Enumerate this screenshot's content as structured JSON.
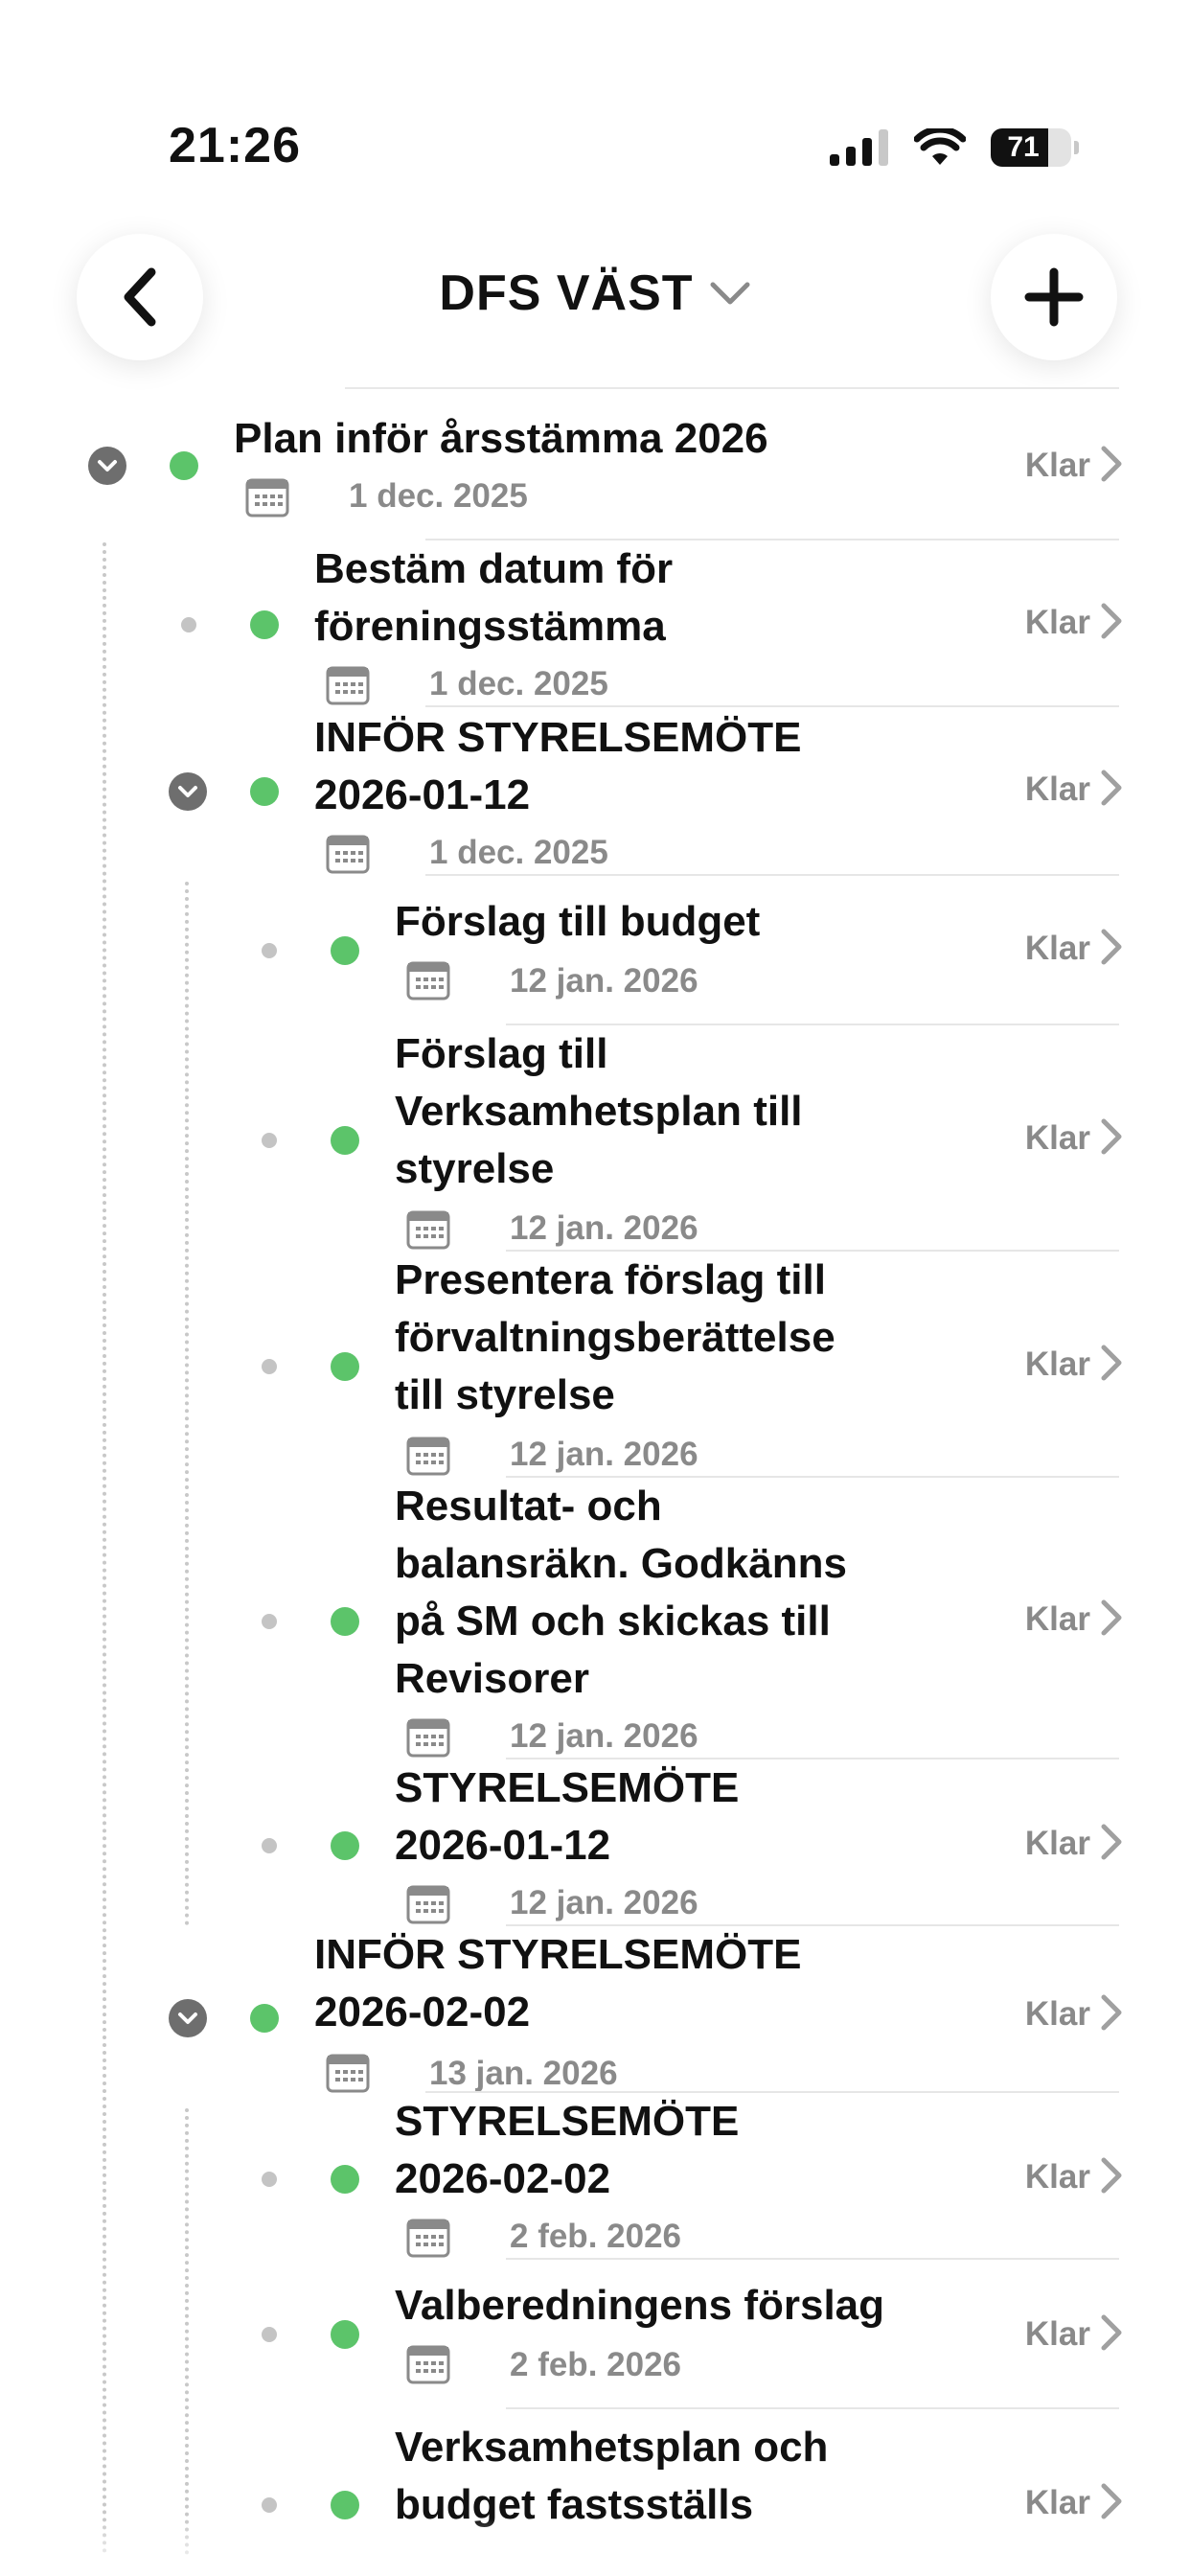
{
  "status_bar": {
    "time": "21:26",
    "battery": "71"
  },
  "header": {
    "title": "DFS VÄST"
  },
  "rows": [
    {
      "title": "Plan inför årsstämma 2026",
      "date": "1 dec. 2025",
      "status": "Klar"
    },
    {
      "title": "Bestäm datum för föreningsstämma",
      "date": "1 dec. 2025",
      "status": "Klar"
    },
    {
      "title": "INFÖR STYRELSEMÖTE 2026-01-12",
      "date": "1 dec. 2025",
      "status": "Klar"
    },
    {
      "title": "Förslag till budget",
      "date": "12 jan. 2026",
      "status": "Klar"
    },
    {
      "title": "Förslag till Verksamhetsplan till styrelse",
      "date": "12 jan. 2026",
      "status": "Klar"
    },
    {
      "title": "Presentera förslag till förvaltningsberättelse till styrelse",
      "date": "12 jan. 2026",
      "status": "Klar"
    },
    {
      "title": "Resultat- och balansräkn. Godkänns på SM och skickas till Revisorer",
      "date": "12 jan. 2026",
      "status": "Klar"
    },
    {
      "title": "STYRELSEMÖTE 2026-01-12",
      "date": "12 jan. 2026",
      "status": "Klar"
    },
    {
      "title": "INFÖR STYRELSEMÖTE 2026-02-02",
      "date": "13 jan. 2026",
      "status": "Klar"
    },
    {
      "title": "STYRELSEMÖTE 2026-02-02",
      "date": "2 feb. 2026",
      "status": "Klar"
    },
    {
      "title": "Valberedningens förslag",
      "date": "2 feb. 2026",
      "status": "Klar"
    },
    {
      "title": "Verksamhetsplan och budget fastsställs",
      "date": "",
      "status": "Klar"
    }
  ]
}
